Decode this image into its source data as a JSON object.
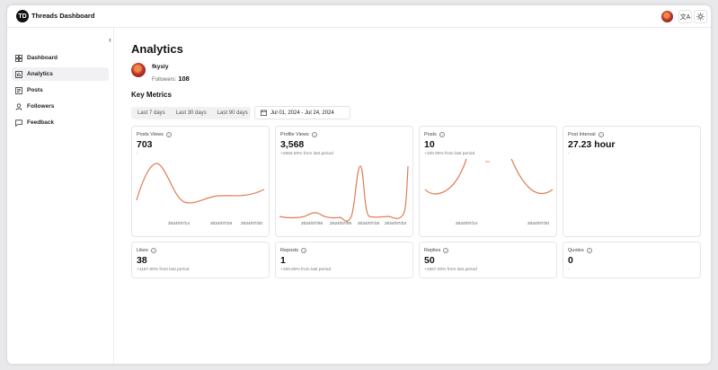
{
  "app": {
    "logo_text": "TD",
    "title": "Threads Dashboard",
    "theme_icon": "sun-icon",
    "translate_icon": "translate-icon"
  },
  "sidebar": {
    "collapse_icon": "chevron-left-icon",
    "items": [
      {
        "label": "Dashboard",
        "icon": "dashboard-icon"
      },
      {
        "label": "Analytics",
        "icon": "chart-icon",
        "active": true
      },
      {
        "label": "Posts",
        "icon": "posts-icon"
      },
      {
        "label": "Followers",
        "icon": "user-icon"
      },
      {
        "label": "Feedback",
        "icon": "message-icon"
      }
    ]
  },
  "page": {
    "title": "Analytics"
  },
  "user": {
    "name": "fkysly",
    "followers_label": "Followers:",
    "followers_count": "108"
  },
  "metrics": {
    "title": "Key Metrics",
    "ranges": [
      "Last 7 days",
      "Last 30 days",
      "Last 90 days"
    ],
    "date_range": "Jul 01, 2024 - Jul 24, 2024"
  },
  "cards": [
    {
      "label": "Posts Views",
      "value": "703",
      "sub": "-",
      "ticks": [
        "2024/07/14",
        "2024/07/18",
        "2024/07/20"
      ]
    },
    {
      "label": "Profile Views",
      "value": "3,568",
      "sub": "+2583.00% from last period",
      "ticks": [
        "2024/07/06",
        "2024/07/09",
        "2024/07/18",
        "2024/07/23"
      ]
    },
    {
      "label": "Posts",
      "value": "10",
      "sub": "+100.00% from last period",
      "ticks": [
        "2024/07/14",
        "2024/07/20"
      ]
    },
    {
      "label": "Post Interval",
      "value": "27.23 hour",
      "sub": "-"
    },
    {
      "label": "Likes",
      "value": "38",
      "sub": "+1167.00% from last period"
    },
    {
      "label": "Reposts",
      "value": "1",
      "sub": "+100.00% from last period"
    },
    {
      "label": "Replies",
      "value": "50",
      "sub": "+1567.00% from last period"
    },
    {
      "label": "Quotes",
      "value": "0",
      "sub": "-"
    }
  ],
  "colors": {
    "accent": "#e07b53",
    "active_bg": "#f1f1f3",
    "border": "#e6e6e9"
  }
}
